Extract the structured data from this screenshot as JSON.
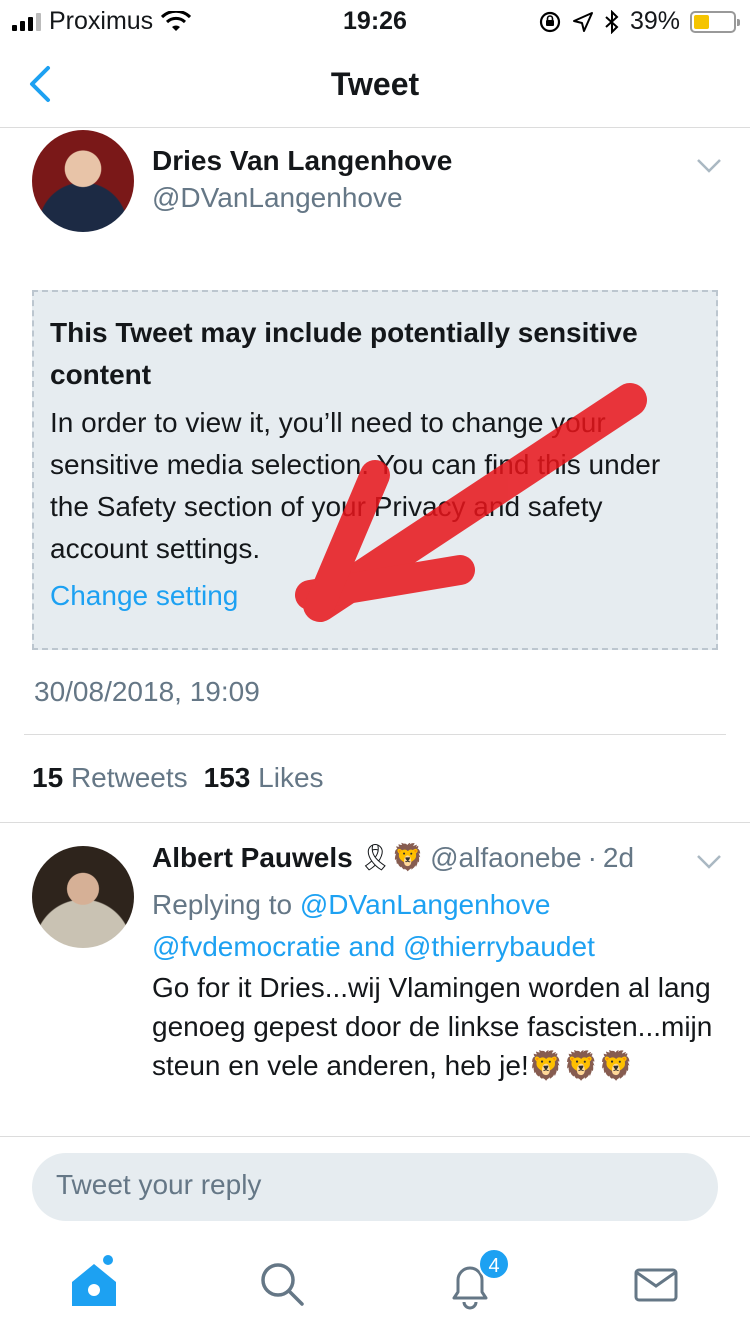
{
  "status_bar": {
    "carrier": "Proximus",
    "time": "19:26",
    "battery": "39%",
    "battery_level": 0.39
  },
  "navbar": {
    "title": "Tweet"
  },
  "tweet": {
    "author_name": "Dries Van Langenhove",
    "author_handle": "@DVanLangenhove",
    "sensitive_title": "This Tweet may include potentially sensitive content",
    "sensitive_body": "In order to view it, you’ll need to change your sensitive media selection. You can find this under the Safety section of your Privacy and safety account settings.",
    "change_setting": "Change setting",
    "timestamp": "30/08/2018, 19:09",
    "retweets_count": "15",
    "retweets_label": "Retweets",
    "likes_count": "153",
    "likes_label": "Likes"
  },
  "reply": {
    "author_name": "Albert Pauwels",
    "name_emojis": "🎗🦁",
    "handle": "@alfaonebe",
    "separator": "·",
    "time": "2d",
    "replying_prefix": "Replying to",
    "mention_1": "@DVanLangenhove",
    "mention_2": "@fvdemocratie",
    "and_word": "and",
    "mention_3": "@thierrybaudet",
    "text": "Go for it Dries...wij Vlamingen worden al lang genoeg gepest door de linkse fascisten...mijn steun en vele anderen, heb je!🦁🦁🦁"
  },
  "compose": {
    "placeholder": "Tweet your reply"
  },
  "tabbar": {
    "notifications_badge": "4"
  },
  "colors": {
    "accent": "#1da1f2",
    "muted": "#657786",
    "box_bg": "#e6ecf0",
    "annotation_red": "#e8141a"
  }
}
